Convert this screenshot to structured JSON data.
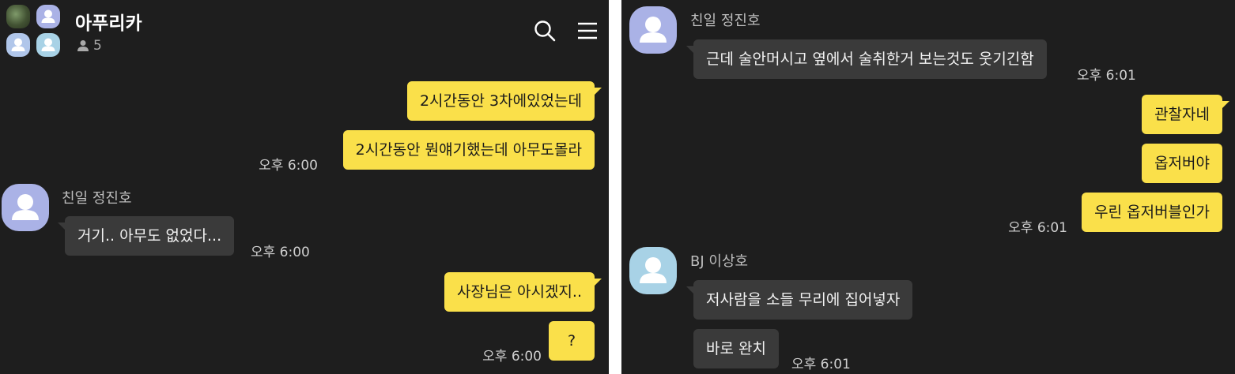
{
  "left_panel": {
    "header": {
      "title": "아푸리카",
      "member_count": "5",
      "icons": [
        "group-avatar-icon",
        "person-icon",
        "search-icon",
        "menu-icon"
      ]
    },
    "messages": [
      {
        "type": "me",
        "text": "2시간동안 3차에있었는데"
      },
      {
        "type": "me",
        "text": "2시간동안 뭔얘기했는데 아무도몰라",
        "time": "오후 6:00"
      },
      {
        "type": "other",
        "sender": "친일 정진호",
        "text": "거기.. 아무도 없었다...",
        "time": "오후 6:00"
      },
      {
        "type": "me",
        "text": "사장님은 아시겠지.."
      },
      {
        "type": "me",
        "text": "?",
        "time": "오후 6:00"
      }
    ]
  },
  "right_panel": {
    "messages": [
      {
        "type": "other",
        "sender": "친일 정진호",
        "text": "근데 술안머시고 옆에서 술취한거 보는것도 웃기긴함",
        "time": "오후 6:01"
      },
      {
        "type": "me",
        "text": "관찰자네"
      },
      {
        "type": "me",
        "text": "옵저버야"
      },
      {
        "type": "me",
        "text": "우린 옵저버블인가",
        "time": "오후 6:01"
      },
      {
        "type": "other",
        "sender": "BJ 이상호",
        "text": "저사람을 소들 무리에 집어넣자"
      },
      {
        "type": "other",
        "text": "바로 완치",
        "time": "오후 6:01"
      }
    ]
  },
  "colors": {
    "background": "#1e1e1e",
    "my_bubble": "#fae04a",
    "other_bubble": "#3a3a3a",
    "avatar_purple": "#aab2e6",
    "avatar_blue": "#a8d2e6"
  }
}
